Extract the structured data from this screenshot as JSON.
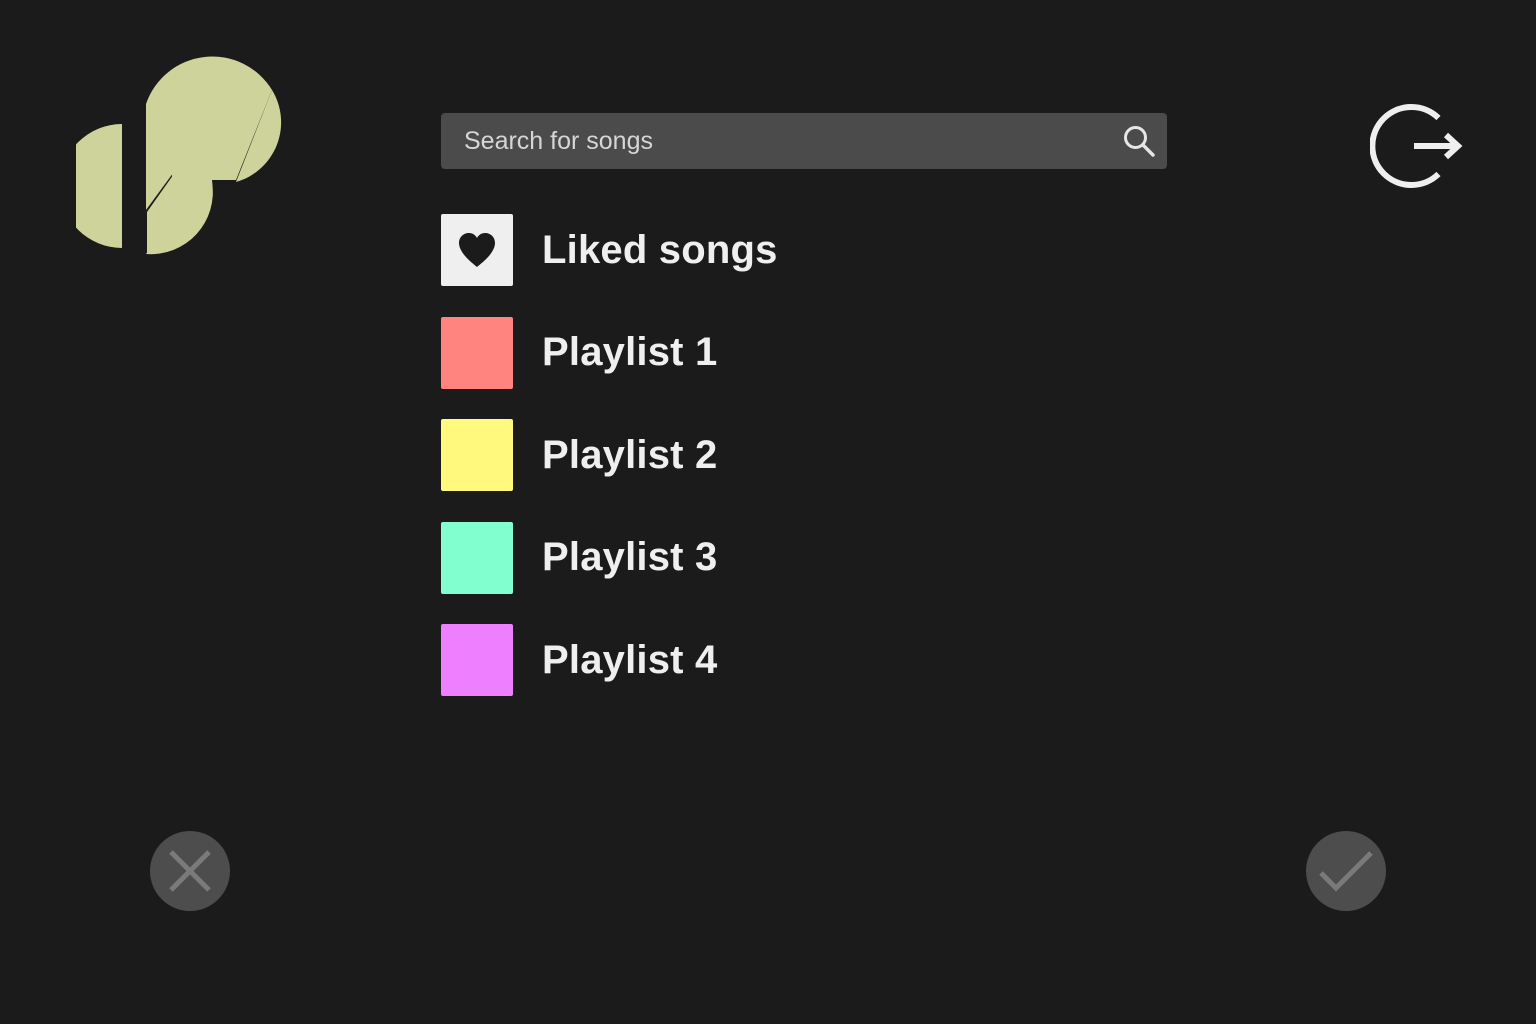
{
  "app": {
    "logo_icon": "stylized-music-note-logo-icon",
    "brand_color": "#cdd39b"
  },
  "search": {
    "placeholder": "Search for songs",
    "value": "",
    "icon": "search-icon"
  },
  "header": {
    "logout_icon": "logout-icon"
  },
  "playlists": [
    {
      "label": "Liked songs",
      "color": "#efefef",
      "icon": "heart-icon"
    },
    {
      "label": "Playlist 1",
      "color": "#ff8480"
    },
    {
      "label": "Playlist 2",
      "color": "#fffa7e"
    },
    {
      "label": "Playlist 3",
      "color": "#82ffcf"
    },
    {
      "label": "Playlist 4",
      "color": "#ee80ff"
    }
  ],
  "actions": {
    "cancel_icon": "close-icon",
    "confirm_icon": "checkmark-icon",
    "button_color": "#4d4d4d",
    "icon_color": "#7a7a7a"
  }
}
